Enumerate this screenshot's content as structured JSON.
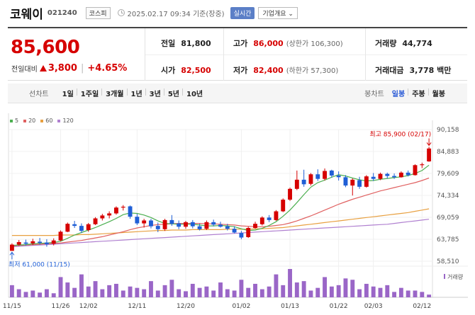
{
  "header": {
    "name": "코웨이",
    "code": "021240",
    "market": "코스피",
    "timestamp": "2025.02.17 09:34 기준(장중)",
    "realtime_label": "실시간",
    "company_label": "기업개요 ⌄"
  },
  "quote": {
    "price": "85,600",
    "change_label": "전일대비",
    "change": "3,800",
    "change_pct": "+4.65%",
    "prev_label": "전일",
    "prev": "81,800",
    "open_label": "시가",
    "open": "82,500",
    "high_label": "고가",
    "high": "86,000",
    "upper_limit": "(상한가 106,300)",
    "low_label": "저가",
    "low": "82,400",
    "lower_limit": "(하한가 57,300)",
    "volume_label": "거래량",
    "volume": "44,774",
    "amount_label": "거래대금",
    "amount": "3,778 백만"
  },
  "periods": {
    "chart_label": "선차트",
    "items": [
      "1일",
      "1주일",
      "3개월",
      "1년",
      "3년",
      "5년",
      "10년"
    ],
    "candle_label": "봉차트",
    "candle_items": [
      "일봉",
      "주봉",
      "월봉"
    ],
    "active_candle": "일봉"
  },
  "colors": {
    "up": "#d60000",
    "down": "#1f5fd6",
    "ma5": "#4caf50",
    "ma20": "#e06060",
    "ma60": "#e8a040",
    "ma120": "#b080d0",
    "accent": "#5b7fc7"
  },
  "chart_data": {
    "type": "candlestick",
    "legend": [
      {
        "name": "5",
        "color": "#4caf50"
      },
      {
        "name": "20",
        "color": "#e06060"
      },
      {
        "name": "60",
        "color": "#e8a040"
      },
      {
        "name": "120",
        "color": "#b080d0"
      }
    ],
    "y_ticks": [
      "90,158",
      "84,883",
      "79,609",
      "74,334",
      "69,059",
      "63,785",
      "58,510"
    ],
    "y_min": 58510,
    "y_max": 90158,
    "x_ticks": [
      {
        "label": "11/15",
        "i": 0
      },
      {
        "label": "11/26",
        "i": 7
      },
      {
        "label": "12/02",
        "i": 11
      },
      {
        "label": "12/11",
        "i": 18
      },
      {
        "label": "12/20",
        "i": 25
      },
      {
        "label": "01/02",
        "i": 33
      },
      {
        "label": "01/13",
        "i": 40
      },
      {
        "label": "01/22",
        "i": 47
      },
      {
        "label": "02/03",
        "i": 52
      },
      {
        "label": "02/12",
        "i": 59
      }
    ],
    "max_annotation": "최고 85,900 (02/17)",
    "min_annotation": "최저 61,000 (11/15)",
    "volume_label": "거래량",
    "candles": [
      [
        61000,
        62800,
        61000,
        62500
      ],
      [
        62500,
        63600,
        62200,
        63100
      ],
      [
        63000,
        63700,
        62300,
        62700
      ],
      [
        62800,
        63900,
        62400,
        63300
      ],
      [
        63200,
        64100,
        62500,
        62900
      ],
      [
        63000,
        63800,
        62000,
        62600
      ],
      [
        62700,
        64000,
        62300,
        63500
      ],
      [
        63500,
        65900,
        63300,
        65600
      ],
      [
        65600,
        67800,
        65500,
        67500
      ],
      [
        67400,
        68200,
        66500,
        67000
      ],
      [
        67000,
        67600,
        65300,
        65800
      ],
      [
        66000,
        67700,
        65600,
        67400
      ],
      [
        67400,
        69100,
        67200,
        68800
      ],
      [
        68800,
        69900,
        68300,
        69500
      ],
      [
        69500,
        70500,
        68800,
        70000
      ],
      [
        70000,
        71700,
        69700,
        71400
      ],
      [
        71400,
        72000,
        70700,
        71600
      ],
      [
        71700,
        71900,
        68700,
        69200
      ],
      [
        69200,
        69900,
        67200,
        67600
      ],
      [
        67600,
        68700,
        66600,
        68300
      ],
      [
        68300,
        68700,
        66400,
        66900
      ],
      [
        67000,
        67800,
        65500,
        66200
      ],
      [
        66200,
        68700,
        65800,
        68400
      ],
      [
        68400,
        69600,
        67000,
        67500
      ],
      [
        67600,
        68300,
        66200,
        66800
      ],
      [
        66800,
        68200,
        66300,
        67900
      ],
      [
        67900,
        68400,
        66400,
        66900
      ],
      [
        66900,
        67500,
        65900,
        66200
      ],
      [
        66300,
        68300,
        66000,
        67900
      ],
      [
        67900,
        68500,
        66900,
        67300
      ],
      [
        67300,
        68000,
        66600,
        66800
      ],
      [
        66900,
        67500,
        65900,
        66300
      ],
      [
        66300,
        66900,
        65200,
        65400
      ],
      [
        65300,
        65800,
        63800,
        64200
      ],
      [
        64300,
        66800,
        64100,
        66500
      ],
      [
        66500,
        68000,
        66300,
        67500
      ],
      [
        67400,
        69300,
        67100,
        69000
      ],
      [
        69000,
        69600,
        67900,
        68400
      ],
      [
        68400,
        70800,
        68200,
        70500
      ],
      [
        70500,
        73600,
        70300,
        73300
      ],
      [
        73300,
        76200,
        73000,
        75900
      ],
      [
        75900,
        80300,
        75600,
        78100
      ],
      [
        78100,
        80500,
        76400,
        77000
      ],
      [
        77100,
        79700,
        76700,
        79400
      ],
      [
        79400,
        80600,
        77800,
        78300
      ],
      [
        78300,
        80800,
        77900,
        80200
      ],
      [
        80300,
        80500,
        78600,
        79100
      ],
      [
        79100,
        80100,
        77900,
        78700
      ],
      [
        78700,
        79200,
        76300,
        76700
      ],
      [
        76700,
        78400,
        74300,
        78100
      ],
      [
        78000,
        78800,
        75900,
        76400
      ],
      [
        76400,
        79200,
        76200,
        78900
      ],
      [
        78800,
        79700,
        77800,
        78300
      ],
      [
        78300,
        79800,
        78000,
        79500
      ],
      [
        79500,
        79800,
        78400,
        79000
      ],
      [
        79000,
        79600,
        78300,
        78700
      ],
      [
        78700,
        80100,
        78600,
        79800
      ],
      [
        79800,
        80300,
        78900,
        79200
      ],
      [
        79200,
        81800,
        79100,
        81600
      ],
      [
        81600,
        82200,
        80900,
        81800
      ],
      [
        82500,
        86000,
        82400,
        85600
      ]
    ],
    "volumes": [
      18,
      12,
      8,
      10,
      7,
      12,
      6,
      30,
      22,
      14,
      34,
      16,
      24,
      12,
      18,
      20,
      10,
      16,
      14,
      12,
      24,
      10,
      18,
      26,
      12,
      9,
      20,
      14,
      16,
      10,
      22,
      12,
      10,
      26,
      14,
      20,
      12,
      16,
      34,
      18,
      42,
      22,
      24,
      10,
      14,
      30,
      16,
      18,
      28,
      26,
      12,
      20,
      16,
      14,
      18,
      8,
      14,
      10,
      10,
      8,
      4
    ],
    "ma5": [
      62300,
      62400,
      62500,
      62700,
      62800,
      62900,
      63000,
      63300,
      64000,
      64800,
      65400,
      66000,
      66600,
      67300,
      68000,
      68800,
      69700,
      70100,
      70000,
      69600,
      69000,
      68200,
      67600,
      67500,
      67400,
      67400,
      67400,
      67200,
      67000,
      67000,
      67100,
      67000,
      66800,
      66300,
      65900,
      66000,
      66400,
      67100,
      68000,
      69300,
      70800,
      72600,
      74500,
      76300,
      77400,
      78000,
      78700,
      79300,
      79000,
      78500,
      78100,
      77800,
      77900,
      78200,
      78400,
      78600,
      78800,
      79100,
      79600,
      80300,
      81600
    ],
    "ma20": [
      62200,
      62300,
      62400,
      62500,
      62600,
      62700,
      62800,
      62900,
      63100,
      63300,
      63500,
      63800,
      64100,
      64400,
      64800,
      65200,
      65600,
      66100,
      66500,
      66800,
      67100,
      67300,
      67400,
      67500,
      67600,
      67600,
      67600,
      67600,
      67500,
      67500,
      67400,
      67300,
      67200,
      67000,
      66900,
      66800,
      66800,
      66900,
      67100,
      67300,
      67700,
      68200,
      68800,
      69400,
      70100,
      70800,
      71500,
      72200,
      72800,
      73400,
      73900,
      74400,
      74900,
      75400,
      75800,
      76200,
      76600,
      77000,
      77400,
      77900,
      78500
    ],
    "ma60": [
      64700,
      64700,
      64700,
      64700,
      64700,
      64700,
      64700,
      64800,
      64800,
      64800,
      64900,
      64900,
      65000,
      65100,
      65200,
      65300,
      65400,
      65500,
      65600,
      65700,
      65800,
      65900,
      65900,
      66000,
      66000,
      66000,
      66100,
      66100,
      66100,
      66100,
      66100,
      66200,
      66200,
      66200,
      66200,
      66300,
      66300,
      66400,
      66500,
      66600,
      66800,
      67000,
      67200,
      67400,
      67600,
      67800,
      68000,
      68200,
      68400,
      68600,
      68800,
      69000,
      69200,
      69400,
      69600,
      69800,
      70000,
      70200,
      70500,
      70800,
      71100
    ],
    "ma120": [
      62000,
      62100,
      62200,
      62300,
      62400,
      62500,
      62600,
      62700,
      62800,
      62900,
      63000,
      63100,
      63200,
      63300,
      63400,
      63500,
      63600,
      63700,
      63800,
      63900,
      64000,
      64100,
      64200,
      64300,
      64400,
      64500,
      64600,
      64700,
      64800,
      64900,
      65000,
      65100,
      65200,
      65300,
      65400,
      65500,
      65600,
      65700,
      65800,
      65900,
      66000,
      66100,
      66200,
      66300,
      66400,
      66500,
      66600,
      66700,
      66800,
      66900,
      67000,
      67100,
      67200,
      67300,
      67400,
      67600,
      67800,
      68000,
      68200,
      68400,
      68600
    ]
  }
}
